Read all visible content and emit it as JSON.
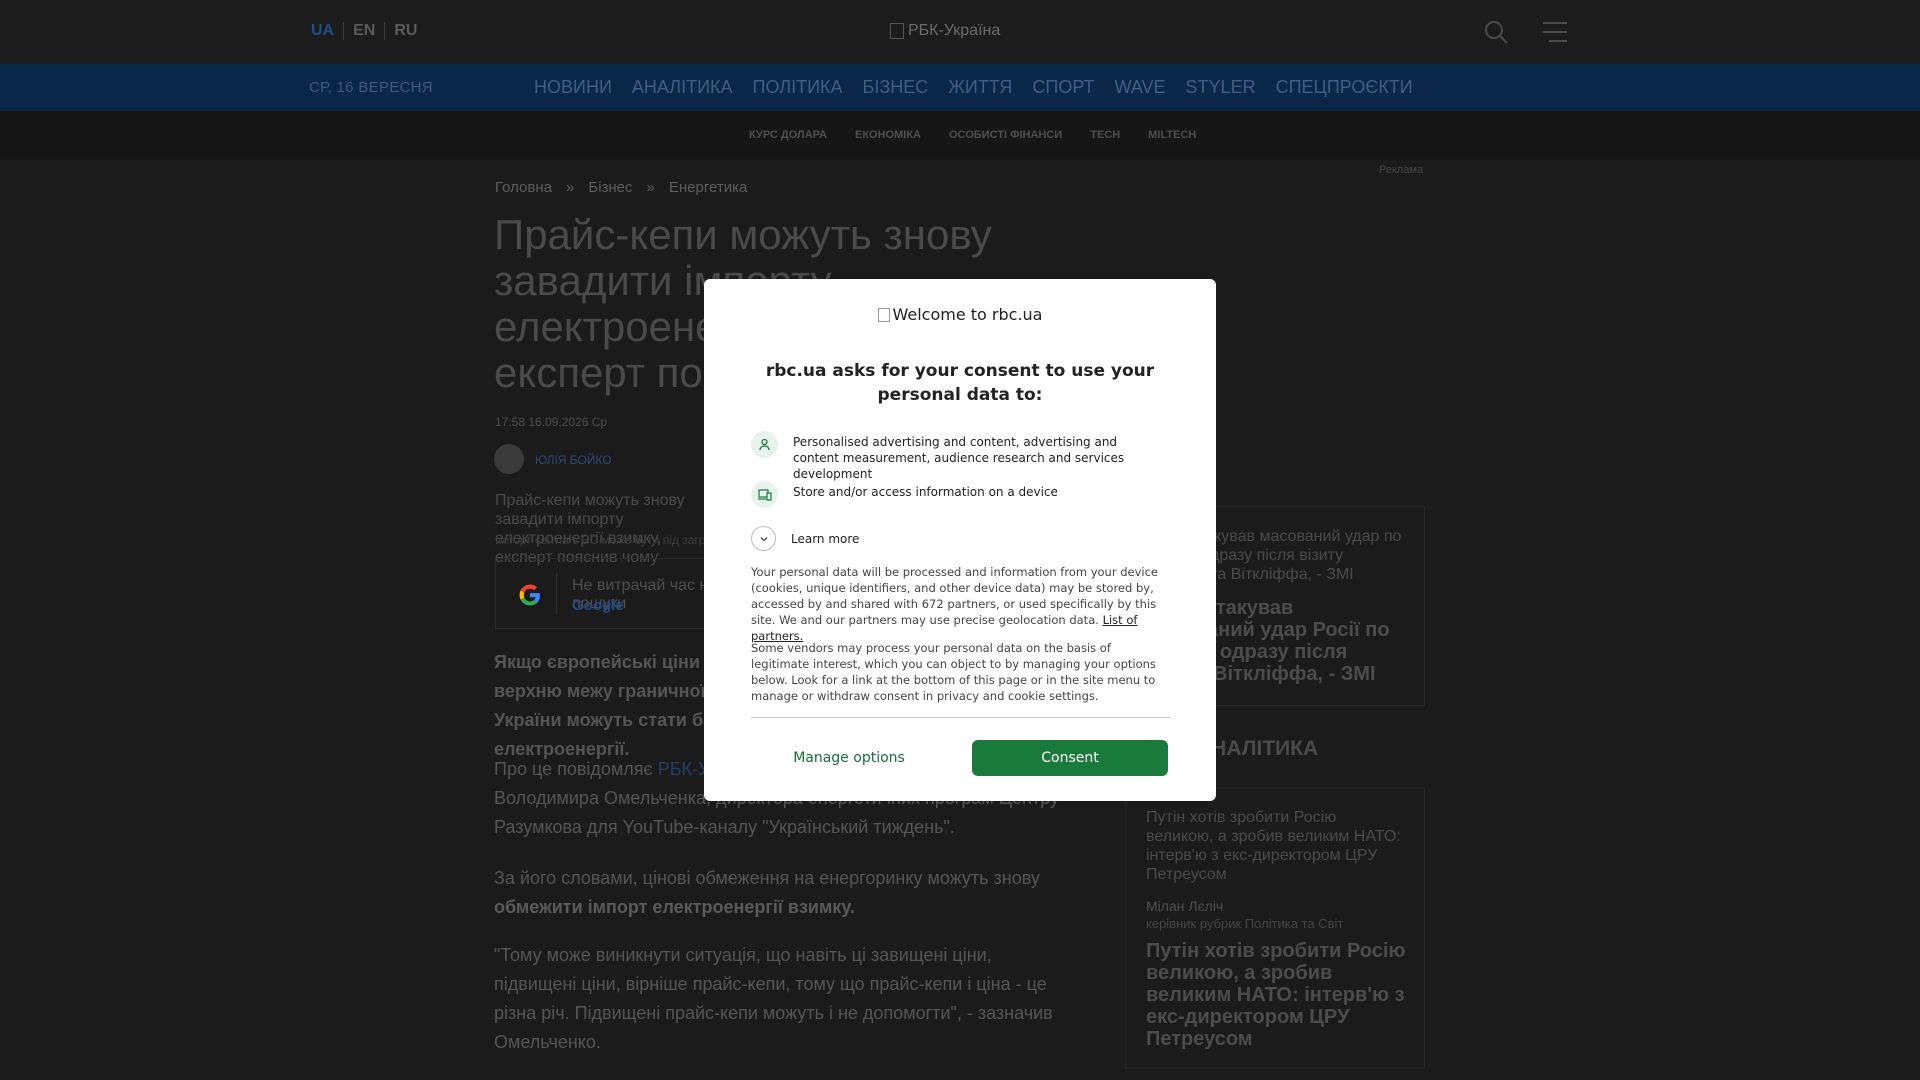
{
  "header": {
    "langs": [
      "UA",
      "EN",
      "RU"
    ],
    "logo_alt": "РБК-Україна"
  },
  "mainnav": {
    "date": "СР, 16 ВЕРЕСНЯ",
    "items": [
      "НОВИНИ",
      "АНАЛІТИКА",
      "ПОЛІТИКА",
      "БІЗНЕС",
      "ЖИТТЯ",
      "СПОРТ",
      "WAVE",
      "STYLER",
      "СПЕЦПРОЄКТИ"
    ]
  },
  "subnav": {
    "items": [
      "КУРС ДОЛАРА",
      "ЕКОНОМІКА",
      "ОСОБИСТІ ФІНАНСИ",
      "TECH",
      "MILTECH"
    ]
  },
  "ad_label": "Реклама",
  "breadcrumb": [
    "Головна",
    "»",
    "Бізнес",
    "»",
    "Енергетика"
  ],
  "article": {
    "title": "Прайс-кепи можуть знову завадити імпорту електроенергії взимку, експерт пояснив чому",
    "timestamp": "17:58 16.09.2026 Ср",
    "author": "ЮЛІЯ БОЙКО",
    "image_alt": "Прайс-кепи можуть знову завадити імпорту електроенергії взимку, експерт пояснив чому",
    "caption": "Імпорт світла з ЄС може бути під загрозою",
    "google_text": "Не витрачай час на пошуки",
    "google_link": "Google",
    "lead": "Якщо європейські ціни на електроенергію будуть вищими за верхню межу граничної ціни, чинні обмеження на енергоринку України можуть стати бар'єром для закупівлі імпортної електроенергії.",
    "p1_pre": "Про це повідомляє ",
    "p1_link": "РБК-Україна",
    "p1_post": " з посиланням на слова Володимира Омельченка, директора енергетичних програм Центру Разумкова для YouTube-каналу \"Український тиждень\".",
    "p2_pre": "За його словами, цінові обмеження на енергоринку можуть знову ",
    "p2_bold": "обмежити імпорт електроенергії взимку.",
    "p3": "\"Тому може виникнути ситуація, що навіть ці завищені ціни, підвищені ціни, вірніше прайс-кепи, тому що прайс-кепи і ціна - це різна річ. Підвищені прайс-кепи можуть і не допомогти\", - зазначив Омельченко."
  },
  "sidebar": {
    "card1_alt": "Росія атакував масований удар по Україні одразу після візиту Келлога та Віткліффа, - ЗМІ",
    "card1_headline": "Росія атакував масований удар Росії по Україні одразу після візиту Віткліффа, - ЗМІ",
    "section_title": "АНАЛІТИКА",
    "card2_alt": "Путін хотів зробити Росію великою, а зробив великим НАТО: інтерв'ю з екс-директором ЦРУ Петреусом",
    "card2_author": "Мілан Лєліч",
    "card2_role": "керівник рубрик Політика та Світ",
    "card2_headline": "Путін хотів зробити Росію великою, а зробив великим НАТО: інтерв'ю з екс-директором ЦРУ Петреусом"
  },
  "modal": {
    "welcome": "Welcome to rbc.ua",
    "title": "rbc.ua asks for your consent to use your personal data to:",
    "purpose1": "Personalised advertising and content, advertising and content measurement, audience research and services development",
    "purpose2": "Store and/or access information on a device",
    "learn_more": "Learn more",
    "info1": "Your personal data will be processed and information from your device (cookies, unique identifiers, and other device data) may be stored by, accessed by and shared with 672 partners, or used specifically by this site. We and our partners may use precise geolocation data. ",
    "partners_link": "List of partners.",
    "info2": "Some vendors may process your personal data on the basis of legitimate interest, which you can object to by managing your options below. Look for a link at the bottom of this page or in the site menu to manage or withdraw consent in privacy and cookie settings.",
    "manage_label": "Manage options",
    "consent_label": "Consent",
    "accent_color": "#1a7a3c"
  }
}
